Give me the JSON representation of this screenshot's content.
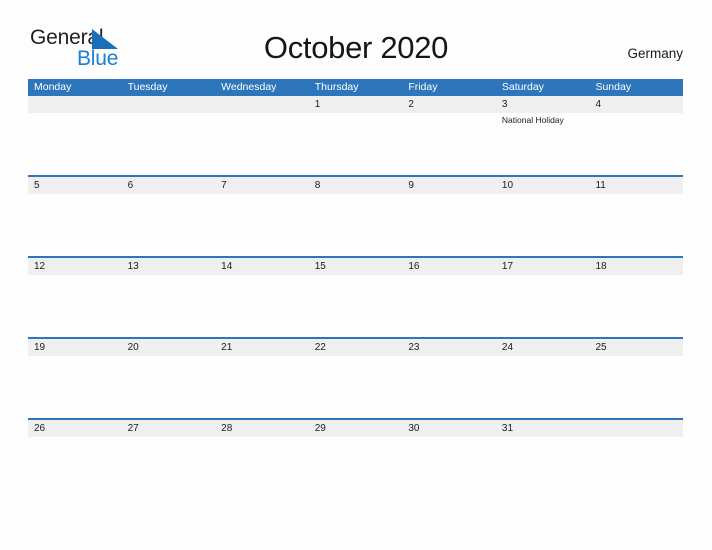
{
  "brand": {
    "name_part1": "General",
    "name_part2": "Blue",
    "flag_icon": "flag-triangle-icon",
    "color_dark": "#231f20",
    "color_blue": "#1b7fd4"
  },
  "header": {
    "title": "October 2020",
    "region": "Germany"
  },
  "theme": {
    "header_blue": "#2e76bc",
    "number_band_gray": "#efefef",
    "page_background": "#fdfdfd",
    "text_dark": "#1c1c1c",
    "weekday_text": "#ffffff"
  },
  "calendar": {
    "weekdays": [
      "Monday",
      "Tuesday",
      "Wednesday",
      "Thursday",
      "Friday",
      "Saturday",
      "Sunday"
    ],
    "weeks": [
      [
        {
          "day": "",
          "events": []
        },
        {
          "day": "",
          "events": []
        },
        {
          "day": "",
          "events": []
        },
        {
          "day": "1",
          "events": []
        },
        {
          "day": "2",
          "events": []
        },
        {
          "day": "3",
          "events": [
            "National Holiday"
          ]
        },
        {
          "day": "4",
          "events": []
        }
      ],
      [
        {
          "day": "5",
          "events": []
        },
        {
          "day": "6",
          "events": []
        },
        {
          "day": "7",
          "events": []
        },
        {
          "day": "8",
          "events": []
        },
        {
          "day": "9",
          "events": []
        },
        {
          "day": "10",
          "events": []
        },
        {
          "day": "11",
          "events": []
        }
      ],
      [
        {
          "day": "12",
          "events": []
        },
        {
          "day": "13",
          "events": []
        },
        {
          "day": "14",
          "events": []
        },
        {
          "day": "15",
          "events": []
        },
        {
          "day": "16",
          "events": []
        },
        {
          "day": "17",
          "events": []
        },
        {
          "day": "18",
          "events": []
        }
      ],
      [
        {
          "day": "19",
          "events": []
        },
        {
          "day": "20",
          "events": []
        },
        {
          "day": "21",
          "events": []
        },
        {
          "day": "22",
          "events": []
        },
        {
          "day": "23",
          "events": []
        },
        {
          "day": "24",
          "events": []
        },
        {
          "day": "25",
          "events": []
        }
      ],
      [
        {
          "day": "26",
          "events": []
        },
        {
          "day": "27",
          "events": []
        },
        {
          "day": "28",
          "events": []
        },
        {
          "day": "29",
          "events": []
        },
        {
          "day": "30",
          "events": []
        },
        {
          "day": "31",
          "events": []
        },
        {
          "day": "",
          "events": []
        }
      ]
    ]
  }
}
